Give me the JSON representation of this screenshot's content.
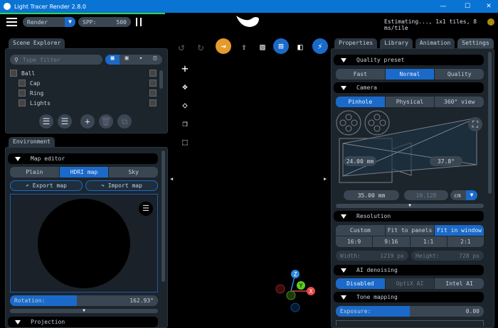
{
  "window": {
    "title": "Light Tracer Render 2.8.0",
    "min": "—",
    "max": "☐",
    "close": "✕"
  },
  "topbar": {
    "mode": "Render",
    "spp_label": "SPP:",
    "spp_value": "500",
    "status": "Estimating..., 1x1 tiles, 8 ms/tile"
  },
  "scene": {
    "tab": "Scene Explorer",
    "filter_placeholder": "Type filter",
    "items": [
      {
        "label": "Ball"
      },
      {
        "label": "Cap"
      },
      {
        "label": "Ring"
      },
      {
        "label": "Lights"
      }
    ]
  },
  "environment": {
    "tab": "Environment",
    "map_editor": "Map editor",
    "modes": [
      "Plain",
      "HDRI map",
      "Sky"
    ],
    "export": "Export map",
    "import": "Import map",
    "rotation_label": "Rotation:",
    "rotation_value": "162.93°",
    "rotation_fraction": 0.45,
    "projection": "Projection"
  },
  "right": {
    "tabs": [
      "Properties",
      "Library",
      "Animation",
      "Settings"
    ],
    "quality": {
      "title": "Quality preset",
      "options": [
        "Fast",
        "Normal",
        "Quality"
      ]
    },
    "camera": {
      "title": "Camera",
      "options": [
        "Pinhole",
        "Physical",
        "360° view"
      ],
      "sensor": "24.00 mm",
      "fov": "37.8°",
      "focal": "35.00 mm",
      "distance": "10.128",
      "unit": "cm"
    },
    "resolution": {
      "title": "Resolution",
      "modes": [
        "Custom",
        "Fit to panels",
        "Fit in window"
      ],
      "ratios": [
        "16:9",
        "9:16",
        "1:1",
        "2:1"
      ],
      "width_label": "Width:",
      "width": "1219 px",
      "height_label": "Height:",
      "height": "728 px"
    },
    "denoise": {
      "title": "AI denoising",
      "options": [
        "Disabled",
        "OptiX AI",
        "Intel AI"
      ]
    },
    "tone": {
      "title": "Tone mapping",
      "exposure_label": "Exposure:",
      "exposure": "0.00",
      "exposure_fraction": 0.5
    }
  },
  "gizmo": {
    "z": "Z",
    "y": "Y",
    "x": "X"
  }
}
